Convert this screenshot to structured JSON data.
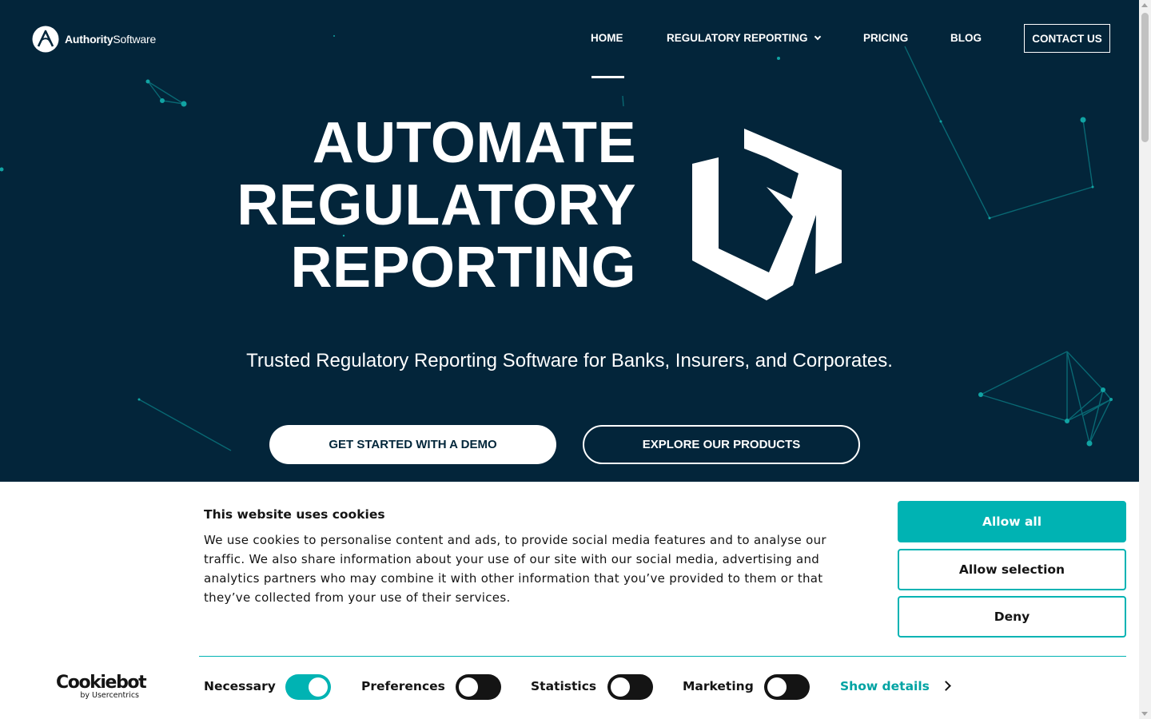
{
  "brand": {
    "name_bold": "Authority",
    "name_light": "Software"
  },
  "nav": {
    "home": "HOME",
    "regulatory_reporting": "REGULATORY REPORTING",
    "pricing": "PRICING",
    "blog": "BLOG",
    "contact": "CONTACT US",
    "active": "HOME"
  },
  "hero": {
    "headline_lines": [
      "AUTOMATE",
      "REGULATORY",
      "REPORTING"
    ],
    "tagline": "Trusted Regulatory Reporting Software for Banks, Insurers, and Corporates.",
    "primary_cta": "GET STARTED WITH A DEMO",
    "secondary_cta": "EXPLORE OUR PRODUCTS"
  },
  "cookie_banner": {
    "title": "This website uses cookies",
    "body": "We use cookies to personalise content and ads, to provide social media features and to analyse our traffic. We also share information about your use of our site with our social media, advertising and analytics partners who may combine it with other information that you’ve provided to them or that they’ve collected from your use of their services.",
    "allow_all": "Allow all",
    "allow_selection": "Allow selection",
    "deny": "Deny",
    "provider": "Cookiebot",
    "provider_sub": "by Usercentrics",
    "toggles": [
      {
        "label": "Necessary",
        "checked": true
      },
      {
        "label": "Preferences",
        "checked": false
      },
      {
        "label": "Statistics",
        "checked": false
      },
      {
        "label": "Marketing",
        "checked": false
      }
    ],
    "show_details": "Show details"
  },
  "colors": {
    "hero_bg": "#03253a",
    "accent": "#00b3b3",
    "network": "#0e9a9a"
  }
}
